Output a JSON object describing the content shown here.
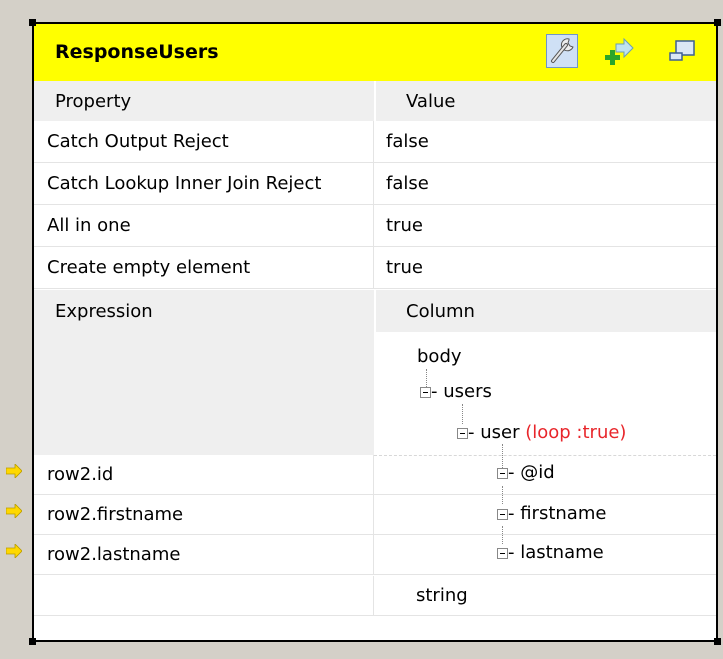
{
  "title": "ResponseUsers",
  "toolbar_icons": [
    "wrench-icon",
    "add-output-icon",
    "minimize-icon"
  ],
  "property_header": {
    "property": "Property",
    "value": "Value"
  },
  "properties": [
    {
      "name": "Catch Output Reject",
      "value": "false"
    },
    {
      "name": "Catch Lookup Inner Join Reject",
      "value": "false"
    },
    {
      "name": "All in one",
      "value": "true"
    },
    {
      "name": "Create empty element",
      "value": "true"
    }
  ],
  "mapping_header": {
    "expression": "Expression",
    "column": "Column"
  },
  "tree": {
    "root": "body",
    "users": "users",
    "user": "user",
    "user_loop": "(loop :true)",
    "id": "@id",
    "firstname": "firstname",
    "lastname": "lastname"
  },
  "expressions": [
    "row2.id",
    "row2.firstname",
    "row2.lastname"
  ],
  "bottom_column": "string",
  "colors": {
    "titlebar": "#ffff00",
    "loop": "#e8262b",
    "header": "#efefef"
  }
}
